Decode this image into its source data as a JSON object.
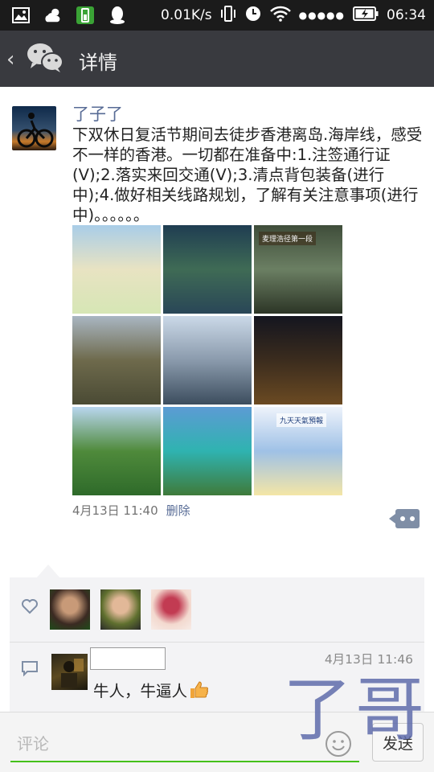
{
  "status_bar": {
    "network_speed": "0.01K/s",
    "signal_dots": "●●●●●",
    "time": "06:34",
    "icons": [
      "image-icon",
      "cloud-sun-icon",
      "battery-app-icon",
      "qq-icon",
      "vibrate-icon",
      "alarm-icon",
      "wifi-icon",
      "battery-charging-icon"
    ]
  },
  "header": {
    "back_label": "‹",
    "title": "详情",
    "logo_icon": "wechat-logo-icon"
  },
  "post": {
    "username": "了子了",
    "text": "下双休日复活节期间去徒步香港离岛.海岸线，感受不一样的香港。一切都在准备中:1.注签通行证(V);2.落实来回交通(V);3.清点背包装备(进行中);4.做好相关线路规划，了解有关注意事项(进行中)。。。。。。",
    "photos": [
      {
        "name": "photo-map-hk",
        "label": "",
        "colors": [
          "#a9cde8",
          "#e8e3c2",
          "#d6e6b5"
        ]
      },
      {
        "name": "photo-map-satellite",
        "label": "",
        "colors": [
          "#1f3d52",
          "#3f6b55",
          "#294657"
        ]
      },
      {
        "name": "photo-trail-sign",
        "label": "麦理浩径第一段",
        "colors": [
          "#3f4d3a",
          "#6b7f63",
          "#2c3526"
        ]
      },
      {
        "name": "photo-mountain-ridge",
        "label": "",
        "colors": [
          "#a9b6c2",
          "#6e6a4c",
          "#4a4a34"
        ]
      },
      {
        "name": "photo-city-aerial",
        "label": "",
        "colors": [
          "#cbd9e8",
          "#8a9aac",
          "#3c4d5e"
        ]
      },
      {
        "name": "photo-night-harbor",
        "label": "",
        "colors": [
          "#14151f",
          "#3b2c1e",
          "#6b4a22"
        ]
      },
      {
        "name": "photo-camping-tents",
        "label": "",
        "colors": [
          "#b9d6ef",
          "#4f8a3b",
          "#2e6a2a"
        ]
      },
      {
        "name": "photo-beach-bay",
        "label": "",
        "colors": [
          "#5c9bd4",
          "#2fb3b0",
          "#3f7a3a"
        ]
      },
      {
        "name": "photo-weather-forecast",
        "label": "九天天氣預報",
        "colors": [
          "#eef3fb",
          "#9fc1e6",
          "#f4e6a6"
        ]
      }
    ],
    "date": "4月13日 11:40",
    "delete_label": "删除"
  },
  "likes": {
    "users": [
      {
        "name": "like-avatar-1",
        "colors": [
          "#3b2a22",
          "#c89a78",
          "#1f4b1a"
        ]
      },
      {
        "name": "like-avatar-2",
        "colors": [
          "#5f6f2e",
          "#e2b898",
          "#2a2a2a"
        ]
      },
      {
        "name": "like-avatar-3",
        "colors": [
          "#f3d9cf",
          "#c23b52",
          "#f7ebe6"
        ]
      }
    ]
  },
  "comments": [
    {
      "username": "",
      "time": "4月13日 11:46",
      "text": "牛人，牛逼人"
    }
  ],
  "watermark": "了哥",
  "input": {
    "placeholder": "评论",
    "send_label": "发送"
  },
  "colors": {
    "status_bar": "#1b1b1b",
    "title_bar": "#393a3f",
    "link": "#576b95",
    "input_accent": "#45c01a"
  }
}
